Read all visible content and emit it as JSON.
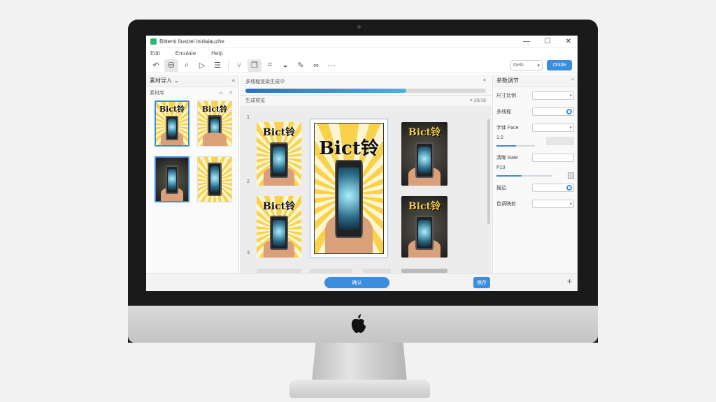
{
  "window": {
    "title": "Bittemi Ilustrel inidaiauzhe",
    "controls": [
      "—",
      "☐",
      "✕"
    ]
  },
  "menu": [
    "Edit",
    "Emulate",
    "Help"
  ],
  "toolbar": {
    "icons": [
      "undo-icon",
      "save-icon",
      "search-icon",
      "play-icon",
      "list-icon",
      "branch-icon",
      "layers-icon",
      "crop-icon",
      "bucket-icon",
      "brush-icon",
      "link-icon",
      "more-icon"
    ],
    "select_label": "Gelo",
    "primary_label": "Ohtde"
  },
  "left_panel": {
    "title": "素材导入",
    "title_arrow": "⌄",
    "header_icon": "≡",
    "subtitle": "素材库",
    "subtitle_icons": "▭ ✕"
  },
  "middle_panel": {
    "progress_label": "多线程渲染生成中",
    "close": "×",
    "progress": 0.67,
    "sub_label": "生成预览",
    "sub_right": "≡ 10/16",
    "row_numbers": [
      "1",
      "2",
      "3"
    ],
    "poster_text": "Bict铃"
  },
  "right_panel": {
    "title": "参数调节",
    "collapse": "^",
    "rows": [
      {
        "label": "尺寸比例"
      },
      {
        "label": "多线程"
      },
      {
        "label": "字体 Face"
      },
      {
        "label": "1.0",
        "slider": 0.5
      },
      {
        "label": "清晰 Rate"
      },
      {
        "label": "P10",
        "slider": 0.45
      },
      {
        "label": "描边"
      },
      {
        "label": "色调映射"
      }
    ]
  },
  "bottom_bar": {
    "main_button": "确认",
    "small_button": "保存",
    "plus": "+"
  }
}
